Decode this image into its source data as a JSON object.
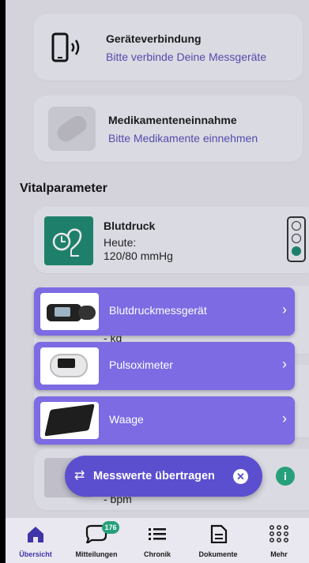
{
  "device_connection": {
    "title": "Geräteverbindung",
    "subtitle": "Bitte verbinde Deine Messgeräte"
  },
  "medication": {
    "title": "Medikamenteneinnahme",
    "subtitle": "Bitte Medikamente einnehmen"
  },
  "vitals": {
    "section_title": "Vitalparameter",
    "blood_pressure": {
      "title": "Blutdruck",
      "date_label": "Heute:",
      "value": "120/80 mmHg"
    },
    "weight_unit": "- kg",
    "pulse_unit": "- bpm"
  },
  "device_menu": [
    {
      "label": "Blutdruckmessgerät",
      "icon": "blood-pressure-monitor"
    },
    {
      "label": "Pulsoximeter",
      "icon": "pulse-oximeter"
    },
    {
      "label": "Waage",
      "icon": "scale"
    }
  ],
  "fab": {
    "label": "Messwerte übertragen"
  },
  "tabbar": {
    "items": [
      {
        "label": "Übersicht",
        "icon": "home-icon"
      },
      {
        "label": "Mitteilungen",
        "icon": "chat-icon",
        "badge": "176"
      },
      {
        "label": "Chronik",
        "icon": "list-icon"
      },
      {
        "label": "Dokumente",
        "icon": "document-icon"
      },
      {
        "label": "Mehr",
        "icon": "grid-icon"
      }
    ]
  },
  "colors": {
    "accent": "#5b4fcf",
    "green": "#26a07a",
    "menu": "#7c6be3"
  }
}
